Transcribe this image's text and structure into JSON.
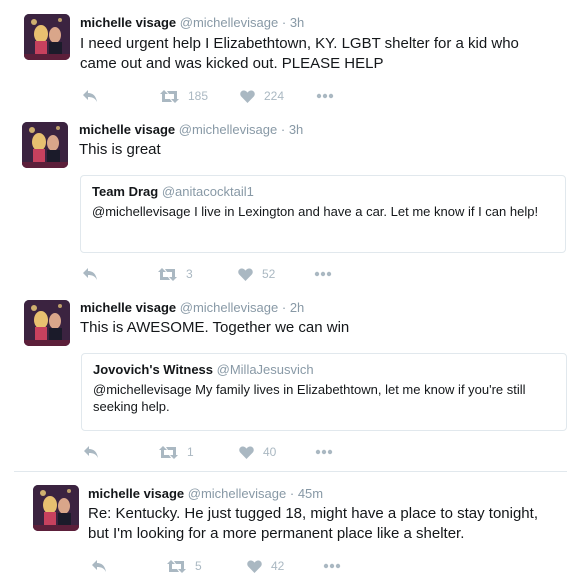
{
  "colors": {
    "text": "#14171a",
    "muted": "#8899a6",
    "icon": "#aab8c2",
    "border": "#e1e8ed"
  },
  "tweets": [
    {
      "name": "michelle visage",
      "handle": "@michellevisage",
      "time": "3h",
      "text": "I need urgent help I Elizabethtown, KY. LGBT shelter for a kid who came out and was kicked out. PLEASE HELP",
      "retweets": "185",
      "likes": "224"
    },
    {
      "name": "michelle visage",
      "handle": "@michellevisage",
      "time": "3h",
      "text": "This is great",
      "quote": {
        "name": "Team Drag",
        "handle": "@anitacocktail1",
        "text": "@michellevisage I live in Lexington and have a car. Let me know if I can help!"
      },
      "retweets": "3",
      "likes": "52"
    },
    {
      "name": "michelle visage",
      "handle": "@michellevisage",
      "time": "2h",
      "text": "This is AWESOME. Together we can win",
      "quote": {
        "name": "Jovovich's Witness",
        "handle": "@MillaJesusvich",
        "text": "@michellevisage My family lives in Elizabethtown, let me know if you're still seeking help."
      },
      "retweets": "1",
      "likes": "40"
    },
    {
      "name": "michelle visage",
      "handle": "@michellevisage",
      "time": "45m",
      "text": "Re: Kentucky. He just tugged 18, might have a place to stay tonight, but I'm looking for a more permanent place like a shelter.",
      "retweets": "5",
      "likes": "42"
    }
  ],
  "separator": "·",
  "icons": {
    "reply": "reply-icon",
    "retweet": "retweet-icon",
    "like": "heart-icon",
    "more": "more-icon"
  }
}
